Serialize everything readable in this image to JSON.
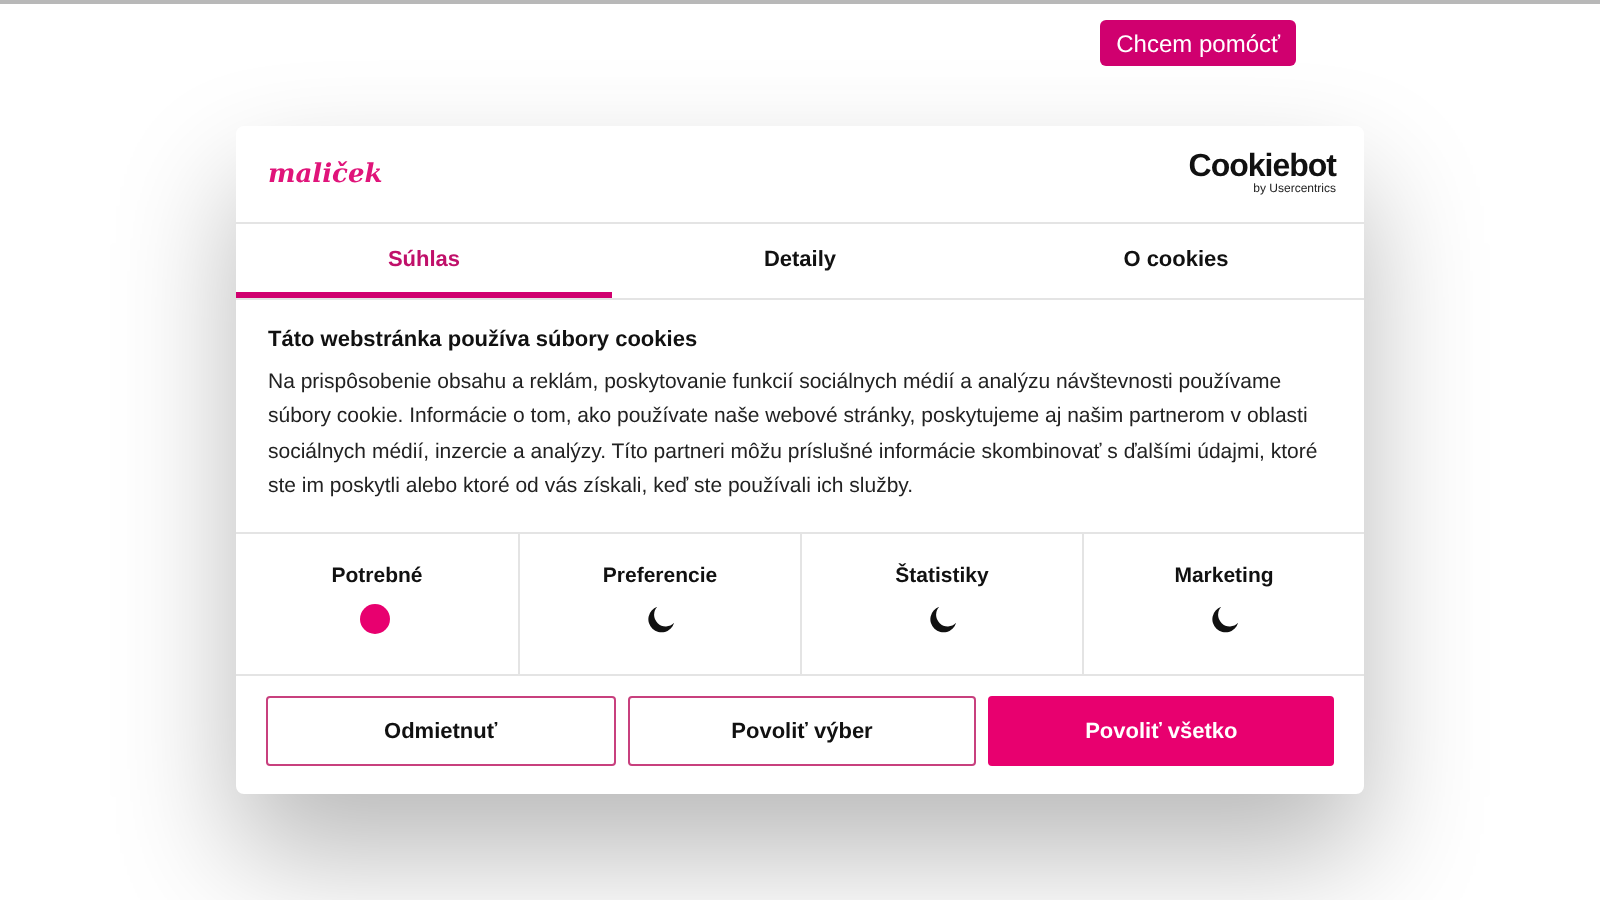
{
  "help_button": "Chcem pomócť",
  "dialog": {
    "logo": "maliček",
    "brand": {
      "name": "Cookiebot",
      "byline": "by Usercentrics"
    },
    "tabs": [
      {
        "label": "Súhlas",
        "selected": true
      },
      {
        "label": "Detaily",
        "selected": false
      },
      {
        "label": "O cookies",
        "selected": false
      }
    ],
    "title": "Táto webstránka používa súbory cookies",
    "text": "Na prispôsobenie obsahu a reklám, poskytovanie funkcií sociálnych médií a analýzu návštevnosti používame súbory cookie. Informácie o tom, ako používate naše webové stránky, poskytujeme aj našim partnerom v oblasti sociálnych médií, inzercie a analýzy. Títo partneri môžu príslušné informácie skombinovať s ďalšími údajmi, ktoré ste im poskytli alebo ktoré od vás získali, keď ste používali ich služby.",
    "categories": [
      {
        "label": "Potrebné",
        "checked": true
      },
      {
        "label": "Preferencie",
        "checked": false
      },
      {
        "label": "Štatistiky",
        "checked": false
      },
      {
        "label": "Marketing",
        "checked": false
      }
    ],
    "buttons": [
      {
        "label": "Odmietnuť",
        "kind": "outline"
      },
      {
        "label": "Povoliť výber",
        "kind": "outline"
      },
      {
        "label": "Povoliť všetko",
        "kind": "primary"
      }
    ]
  }
}
